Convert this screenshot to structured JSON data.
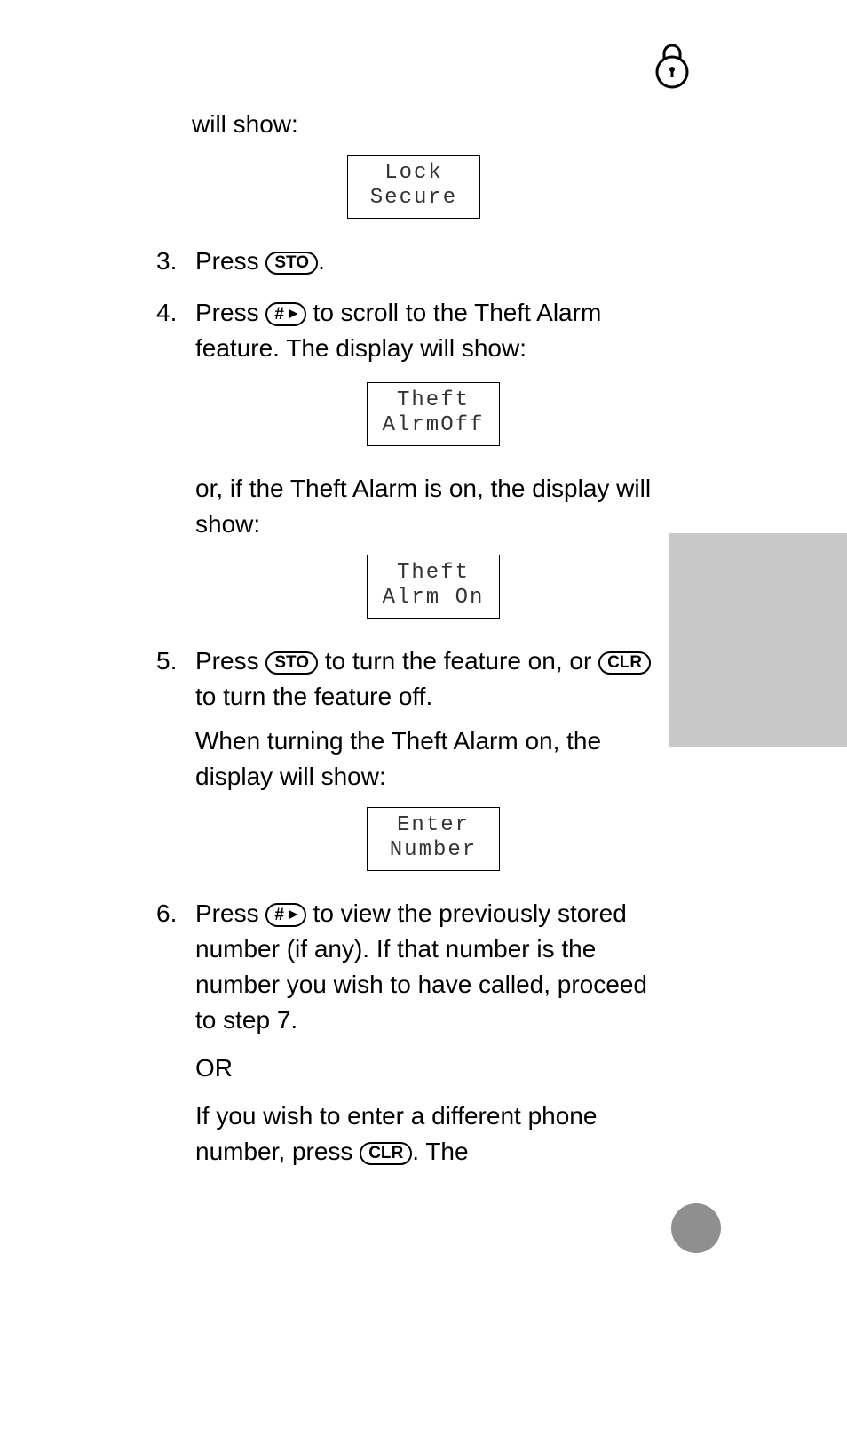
{
  "intro": "will show:",
  "displays": {
    "lock": {
      "line1": "Lock",
      "line2": "Secure"
    },
    "alrmOff": {
      "line1": "Theft",
      "line2": "AlrmOff"
    },
    "alrmOn": {
      "line1": "Theft",
      "line2": "Alrm On"
    },
    "enter": {
      "line1": "Enter",
      "line2": "Number"
    }
  },
  "buttons": {
    "sto": "STO",
    "clr": "CLR",
    "hash": "#"
  },
  "steps": {
    "s3_a": "Press ",
    "s3_b": ".",
    "s4_a": "Press ",
    "s4_b": " to scroll to the Theft Alarm feature. The display will show:",
    "s4_c": "or, if the Theft Alarm is on, the display will show:",
    "s5_a": "Press ",
    "s5_b": " to turn the feature on, or ",
    "s5_c": " to turn the feature off.",
    "s5_d": "When turning the Theft Alarm on, the display will show:",
    "s6_a": "Press ",
    "s6_b": " to view the previously stored number (if any). If that number is the number you wish to have called, proceed to step 7.",
    "s6_or": "OR",
    "s6_c": "If you wish to enter a different phone number, press ",
    "s6_d": ". The"
  }
}
